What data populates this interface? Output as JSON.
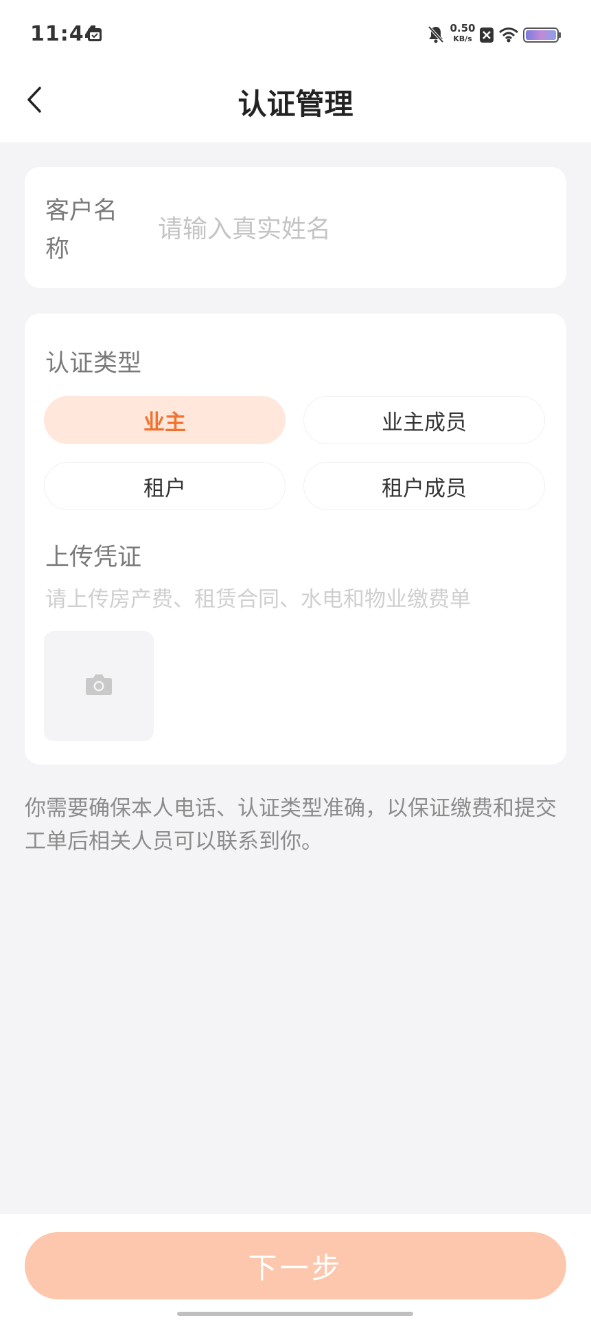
{
  "status_bar": {
    "time": "11:44",
    "net_speed_value": "0.50",
    "net_speed_unit": "KB/s",
    "icons": [
      "calendar-icon",
      "bell-off-icon",
      "notification-x-icon",
      "wifi-icon",
      "battery-icon"
    ]
  },
  "header": {
    "title": "认证管理",
    "back_icon": "chevron-left-icon"
  },
  "customer_name": {
    "label": "客户名称",
    "placeholder": "请输入真实姓名",
    "value": ""
  },
  "auth_type": {
    "label": "认证类型",
    "selected": "业主",
    "options": [
      {
        "label": "业主",
        "selected": true
      },
      {
        "label": "业主成员",
        "selected": false
      },
      {
        "label": "租户",
        "selected": false
      },
      {
        "label": "租户成员",
        "selected": false
      }
    ]
  },
  "upload": {
    "label": "上传凭证",
    "hint": "请上传房产费、租赁合同、水电和物业缴费单",
    "icon": "camera-icon"
  },
  "notice": "你需要确保本人电话、认证类型准确，以保证缴费和提交工单后相关人员可以联系到你。",
  "next_button": "下一步",
  "colors": {
    "accent": "#f2712c",
    "selected_bg": "#ffe7db",
    "button_bg": "#fcc7ad",
    "page_bg": "#f4f4f7"
  }
}
